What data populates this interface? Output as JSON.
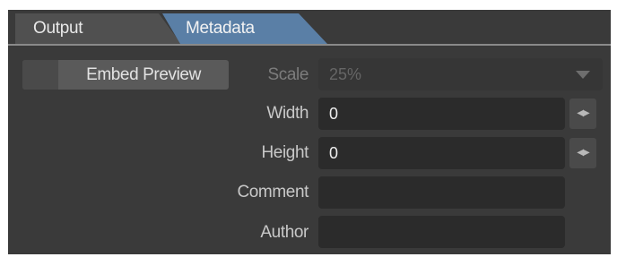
{
  "tabs": [
    {
      "label": "Output",
      "active": false
    },
    {
      "label": "Metadata",
      "active": true
    }
  ],
  "embed_preview": {
    "label": "Embed Preview",
    "checked": false
  },
  "scale": {
    "label": "Scale",
    "value": "25%",
    "disabled": true
  },
  "width": {
    "label": "Width",
    "value": "0",
    "stepper_icon": "left-right-arrows-icon"
  },
  "height": {
    "label": "Height",
    "value": "0",
    "stepper_icon": "left-right-arrows-icon"
  },
  "comment": {
    "label": "Comment",
    "value": ""
  },
  "author": {
    "label": "Author",
    "value": ""
  },
  "colors": {
    "panel_bg": "#3a3a3a",
    "active_tab": "#5a7fa6",
    "inactive_tab": "#505050",
    "field_bg": "#2b2b2b"
  }
}
